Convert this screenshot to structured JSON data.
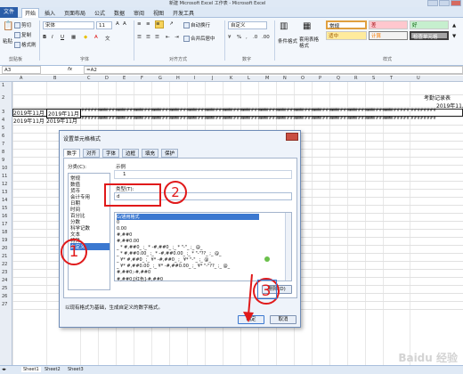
{
  "window_title": "新建 Microsoft Excel 工作表 - Microsoft Excel",
  "tabs": [
    "文件",
    "开始",
    "插入",
    "页面布局",
    "公式",
    "数据",
    "审阅",
    "视图",
    "开发工具"
  ],
  "clipboard": {
    "cut": "剪切",
    "copy": "复制",
    "painter": "格式刷",
    "paste": "粘贴",
    "group": "剪贴板"
  },
  "font": {
    "name": "宋体",
    "size": "11",
    "group": "字体"
  },
  "alignment": {
    "wrap": "自动换行",
    "merge": "合并后居中",
    "group": "对齐方式"
  },
  "number": {
    "format": "自定义",
    "group": "数字"
  },
  "styles_group": {
    "conditional": "条件格式",
    "table": "套用表格格式",
    "group": "样式"
  },
  "style_cells": {
    "normal": "常规",
    "bad": "差",
    "good": "好",
    "neutral": "适中",
    "calc": "计算",
    "check": "检查单元格"
  },
  "formula_bar": {
    "cell_ref": "A3",
    "formula": "=A2",
    "fx": "fx"
  },
  "columns": [
    "A",
    "B",
    "C",
    "D",
    "E",
    "F",
    "G",
    "H",
    "I",
    "J",
    "K",
    "L",
    "M",
    "N",
    "O",
    "P",
    "Q",
    "R",
    "S",
    "T",
    "U"
  ],
  "rows": [
    "1",
    "2",
    "3",
    "4",
    "5",
    "6",
    "7",
    "8",
    "9",
    "10",
    "11",
    "12",
    "13",
    "14",
    "15",
    "16",
    "17",
    "18",
    "19",
    "20",
    "21",
    "22",
    "23",
    "24",
    "25",
    "26",
    "27"
  ],
  "cells": {
    "title": "考勤记录表",
    "month_right": "2019年11月",
    "a3": "2019年11月",
    "b3": "2019年11月",
    "a4": "2019年11月",
    "b4": "2019年11月",
    "hashes": "########"
  },
  "sheets": [
    "Sheet1",
    "Sheet2",
    "Sheet3"
  ],
  "dialog": {
    "title": "设置单元格格式",
    "tabs": [
      "数字",
      "对齐",
      "字体",
      "边框",
      "填充",
      "保护"
    ],
    "category_label": "分类(C):",
    "categories": [
      "常规",
      "数值",
      "货币",
      "会计专用",
      "日期",
      "时间",
      "百分比",
      "分数",
      "科学记数",
      "文本",
      "特殊",
      "自定义"
    ],
    "sample_label": "示例",
    "sample_value": "1",
    "type_label": "类型(T):",
    "type_value": "d",
    "formats": [
      "G/通用格式",
      "0",
      "0.00",
      "#,##0",
      "#,##0.00",
      "_ * #,##0_ ;_ * -#,##0_ ;_ * \"-\"_ ;_ @_",
      "_ * #,##0.00_ ;_ * -#,##0.00_ ;_ * \"-\"??_ ;_ @_",
      "_ ¥* #,##0_ ;_ ¥* -#,##0_ ;_ ¥* \"-\"_ ;_ @_",
      "_ ¥* #,##0.00_ ;_ ¥* -#,##0.00_ ;_ ¥* \"-\"??_ ;_ @_",
      "#,##0;-#,##0",
      "#,##0;[红色]-#,##0"
    ],
    "delete_button": "删除(D)",
    "description": "以现有格式为基础，生成自定义的数字格式。",
    "ok": "确定",
    "cancel": "取消"
  },
  "annotations": {
    "one": "1",
    "two": "2",
    "three": "3"
  },
  "watermark": "Baidu 经验"
}
